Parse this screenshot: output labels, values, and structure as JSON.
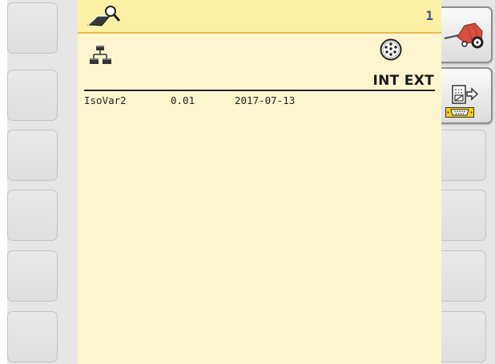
{
  "header": {
    "page_number": "1",
    "title_icon": "machine-search-icon"
  },
  "icons": {
    "network": "network-nodes-icon",
    "connector": "round-connector-icon",
    "port": "serial-port-icon",
    "baler": "round-baler-icon",
    "export": "document-export-icon"
  },
  "columns": {
    "int_ext": "INT EXT"
  },
  "rows": [
    {
      "name": "IsoVar2",
      "version": "0.01",
      "date": "2017-07-13"
    }
  ],
  "colors": {
    "screen_bg": "#fbf6ce",
    "titlebar_bg": "#fbf1a4",
    "titlebar_border": "#e8b94d",
    "page_number": "#4a5080",
    "port_yellow": "#f3d21a",
    "baler_red": "#d9503f"
  }
}
